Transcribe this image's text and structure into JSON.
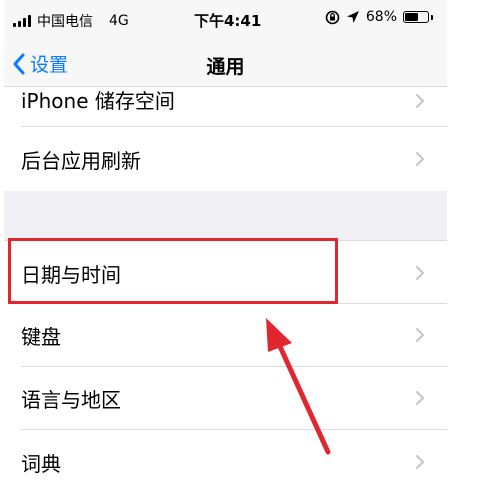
{
  "status_bar": {
    "carrier": "中国电信",
    "network": "4G",
    "time": "下午4:41",
    "battery_percent": "68%",
    "battery_level": 0.68
  },
  "nav": {
    "back_label": "设置",
    "title": "通用"
  },
  "rows": {
    "storage": "iPhone 储存空间",
    "background_refresh": "后台应用刷新",
    "date_time": "日期与时间",
    "keyboard": "键盘",
    "language_region": "语言与地区",
    "dictionary": "词典"
  },
  "annotation": {
    "highlight_color": "#e0262f"
  }
}
